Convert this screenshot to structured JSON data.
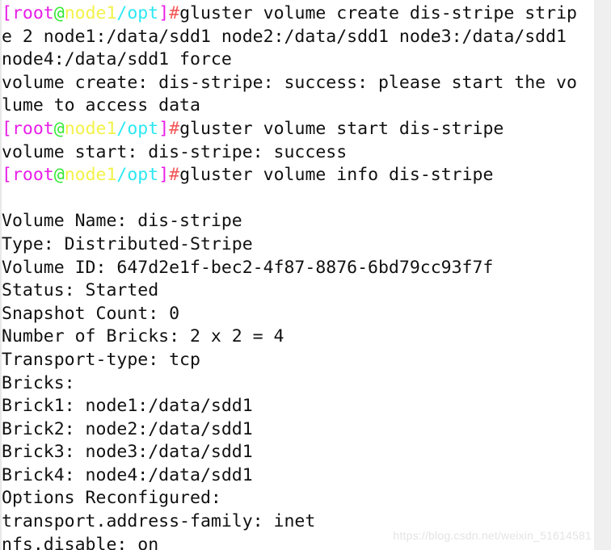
{
  "window": {
    "type": "terminal",
    "background_color": "#ffffff",
    "foreground_color": "#111111",
    "left_gutter_color": "#e8e8e8",
    "right_gutter_color": "#efefef"
  },
  "prompt": {
    "open_bracket": "[",
    "user": "root",
    "at": "@",
    "host": "node1",
    "path": "/opt",
    "close_bracket": "]",
    "sigil": "#",
    "colors": {
      "bracket": "#e81ee8",
      "user": "#e81ee8",
      "at": "#33e833",
      "host": "#f2f24a",
      "path": "#2ce8f2",
      "sigil": "#f45858",
      "command": "#111111"
    }
  },
  "lines": [
    {
      "id": "l01",
      "kind": "prompt",
      "command": "gluster volume create dis-stripe strip"
    },
    {
      "id": "l02",
      "kind": "wrap",
      "text": "e 2 node1:/data/sdd1 node2:/data/sdd1 node3:/data/sdd1"
    },
    {
      "id": "l03",
      "kind": "wrap",
      "text": "node4:/data/sdd1 force"
    },
    {
      "id": "l04",
      "kind": "output",
      "text": "volume create: dis-stripe: success: please start the vo"
    },
    {
      "id": "l05",
      "kind": "wrap",
      "text": "lume to access data"
    },
    {
      "id": "l06",
      "kind": "prompt",
      "command": "gluster volume start dis-stripe"
    },
    {
      "id": "l07",
      "kind": "output",
      "text": "volume start: dis-stripe: success"
    },
    {
      "id": "l08",
      "kind": "prompt",
      "command": "gluster volume info dis-stripe"
    },
    {
      "id": "l09",
      "kind": "blank",
      "text": ""
    },
    {
      "id": "l10",
      "kind": "output",
      "text": "Volume Name: dis-stripe"
    },
    {
      "id": "l11",
      "kind": "output",
      "text": "Type: Distributed-Stripe"
    },
    {
      "id": "l12",
      "kind": "output",
      "text": "Volume ID: 647d2e1f-bec2-4f87-8876-6bd79cc93f7f"
    },
    {
      "id": "l13",
      "kind": "output",
      "text": "Status: Started"
    },
    {
      "id": "l14",
      "kind": "output",
      "text": "Snapshot Count: 0"
    },
    {
      "id": "l15",
      "kind": "output",
      "text": "Number of Bricks: 2 x 2 = 4"
    },
    {
      "id": "l16",
      "kind": "output",
      "text": "Transport-type: tcp"
    },
    {
      "id": "l17",
      "kind": "output",
      "text": "Bricks:"
    },
    {
      "id": "l18",
      "kind": "output",
      "text": "Brick1: node1:/data/sdd1"
    },
    {
      "id": "l19",
      "kind": "output",
      "text": "Brick2: node2:/data/sdd1"
    },
    {
      "id": "l20",
      "kind": "output",
      "text": "Brick3: node3:/data/sdd1"
    },
    {
      "id": "l21",
      "kind": "output",
      "text": "Brick4: node4:/data/sdd1"
    },
    {
      "id": "l22",
      "kind": "output",
      "text": "Options Reconfigured:"
    },
    {
      "id": "l23",
      "kind": "output",
      "text": "transport.address-family: inet"
    },
    {
      "id": "l24",
      "kind": "output",
      "text": "nfs.disable: on"
    }
  ],
  "volume_info": {
    "volume_name": "dis-stripe",
    "type": "Distributed-Stripe",
    "volume_id": "647d2e1f-bec2-4f87-8876-6bd79cc93f7f",
    "status": "Started",
    "snapshot_count": "0",
    "number_of_bricks": "2 x 2 = 4",
    "transport_type": "tcp",
    "bricks": [
      "node1:/data/sdd1",
      "node2:/data/sdd1",
      "node3:/data/sdd1",
      "node4:/data/sdd1"
    ],
    "options_reconfigured": {
      "transport.address-family": "inet",
      "nfs.disable": "on"
    }
  },
  "watermark": {
    "text": "https://blog.csdn.net/weixin_51614581"
  }
}
